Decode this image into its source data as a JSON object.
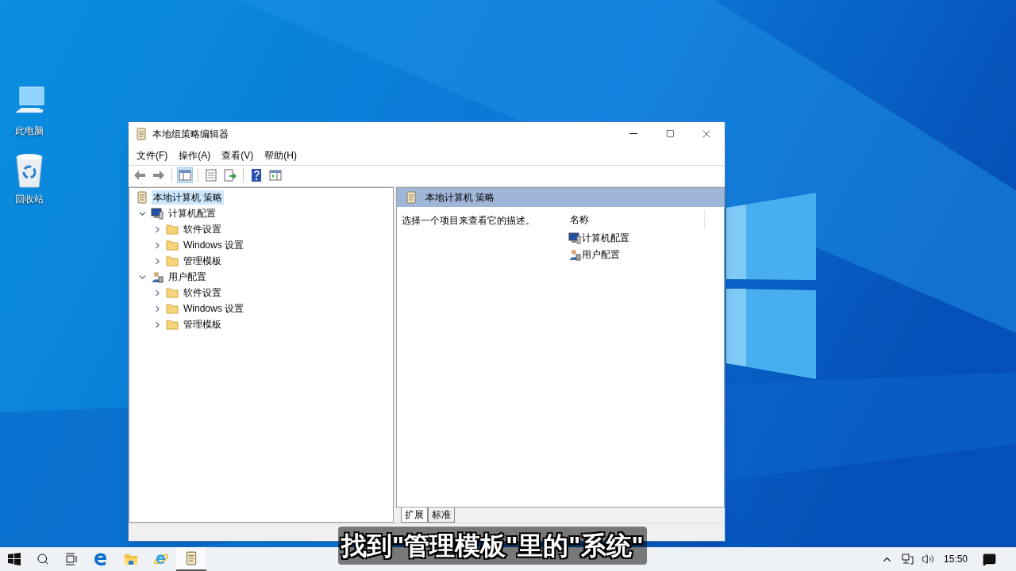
{
  "desktop": {
    "icons": [
      {
        "label": "此电脑",
        "kind": "computer"
      },
      {
        "label": "回收站",
        "kind": "recycle"
      }
    ]
  },
  "window": {
    "title": "本地组策略编辑器",
    "menu": [
      "文件(F)",
      "操作(A)",
      "查看(V)",
      "帮助(H)"
    ],
    "toolbar": [
      {
        "kind": "back",
        "selected": false
      },
      {
        "kind": "forward",
        "selected": false
      },
      {
        "kind": "tree",
        "selected": true
      },
      {
        "kind": "properties",
        "selected": false
      },
      {
        "kind": "export",
        "selected": false
      },
      {
        "kind": "help",
        "selected": false
      },
      {
        "kind": "view",
        "selected": false
      }
    ],
    "tree": {
      "label": "本地计算机 策略",
      "selected": true,
      "children": [
        {
          "label": "计算机配置",
          "kind": "computer",
          "expanded": true,
          "children": [
            {
              "label": "软件设置",
              "kind": "folder",
              "expanded": false
            },
            {
              "label": "Windows 设置",
              "kind": "folder",
              "expanded": false
            },
            {
              "label": "管理模板",
              "kind": "folder",
              "expanded": false
            }
          ]
        },
        {
          "label": "用户配置",
          "kind": "user",
          "expanded": true,
          "children": [
            {
              "label": "软件设置",
              "kind": "folder",
              "expanded": false
            },
            {
              "label": "Windows 设置",
              "kind": "folder",
              "expanded": false
            },
            {
              "label": "管理模板",
              "kind": "folder",
              "expanded": false
            }
          ]
        }
      ]
    },
    "detail": {
      "header": "本地计算机 策略",
      "description": "选择一个项目来查看它的描述。",
      "column": "名称",
      "items": [
        {
          "label": "计算机配置",
          "kind": "computer"
        },
        {
          "label": "用户配置",
          "kind": "user"
        }
      ]
    },
    "tabs": [
      {
        "label": "扩展",
        "selected": true
      },
      {
        "label": "标准",
        "selected": false
      }
    ]
  },
  "taskbar": {
    "apps": [
      {
        "kind": "edge",
        "selected": false
      },
      {
        "kind": "explorer",
        "selected": false
      },
      {
        "kind": "ie",
        "selected": false
      },
      {
        "kind": "policy",
        "selected": true
      }
    ],
    "time": "15:50"
  },
  "caption": "找到\"管理模板\"里的\"系统\""
}
